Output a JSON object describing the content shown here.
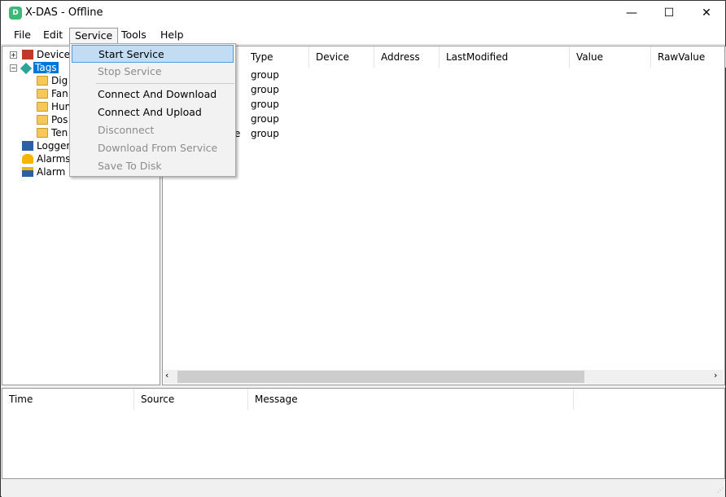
{
  "window": {
    "title": "X-DAS - Offline",
    "icon": "x-das-app-icon",
    "icon_letter": "D",
    "minimize": "—",
    "maximize": "☐",
    "close": "✕"
  },
  "menubar": [
    "File",
    "Edit",
    "Service",
    "Tools",
    "Help"
  ],
  "tree": {
    "devices": "Devices",
    "tags": "Tags",
    "folders": [
      "Dig",
      "Fan",
      "Hum",
      "Pos",
      "Ten"
    ],
    "logger": "Logger",
    "alarms": "Alarms",
    "alarm_log": "Alarm L"
  },
  "list": {
    "columns": [
      "Type",
      "Device",
      "Address",
      "LastModified",
      "Value",
      "RawValue"
    ],
    "rows": [
      {
        "name": "",
        "type": "group"
      },
      {
        "name": "",
        "type": "group"
      },
      {
        "name": "",
        "type": "group"
      },
      {
        "name": "",
        "type": "group"
      },
      {
        "name": "e",
        "type": "group"
      }
    ]
  },
  "log": {
    "columns": [
      "Time",
      "Source",
      "Message"
    ]
  },
  "service_menu": {
    "items": [
      {
        "label": "Start Service",
        "enabled": true,
        "selected": true
      },
      {
        "label": "Stop Service",
        "enabled": false
      },
      {
        "label": "Connect And Download",
        "enabled": true
      },
      {
        "label": "Connect And Upload",
        "enabled": true
      },
      {
        "label": "Disconnect",
        "enabled": false
      },
      {
        "label": "Download From Service",
        "enabled": false
      },
      {
        "label": "Save To Disk",
        "enabled": false
      }
    ]
  },
  "colors": {
    "selection": "#0078d7",
    "menu_highlight": "#c1dcf3"
  }
}
